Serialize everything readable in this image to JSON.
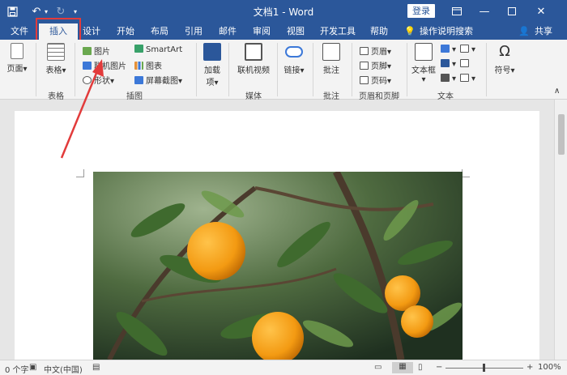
{
  "window": {
    "title": "文档1 - Word",
    "login_label": "登录"
  },
  "tabs": [
    "文件",
    "插入",
    "设计",
    "开始",
    "布局",
    "引用",
    "邮件",
    "审阅",
    "视图",
    "开发工具",
    "帮助"
  ],
  "tell_me": "操作说明搜索",
  "share_label": "共享",
  "ribbon": {
    "page": "页面",
    "table": "表格",
    "picture": "图片",
    "online_picture": "联机图片",
    "shapes": "形状",
    "smartart": "SmartArt",
    "chart": "图表",
    "screenshot": "屏幕截图",
    "addins": "加载项",
    "online_video": "联机视频",
    "link": "链接",
    "comment": "批注",
    "header": "页眉",
    "footer": "页脚",
    "page_number": "页码",
    "textbox": "文本框",
    "symbol": "符号",
    "groups": {
      "table": "表格",
      "illustrations": "插图",
      "media": "媒体",
      "comment": "批注",
      "header_footer": "页眉和页脚",
      "text": "文本"
    }
  },
  "status": {
    "word_count": "0 个字",
    "language": "中文(中国)",
    "zoom": "100%"
  },
  "colors": {
    "title_blue": "#2b579a",
    "highlight_red": "#e23b3b"
  }
}
